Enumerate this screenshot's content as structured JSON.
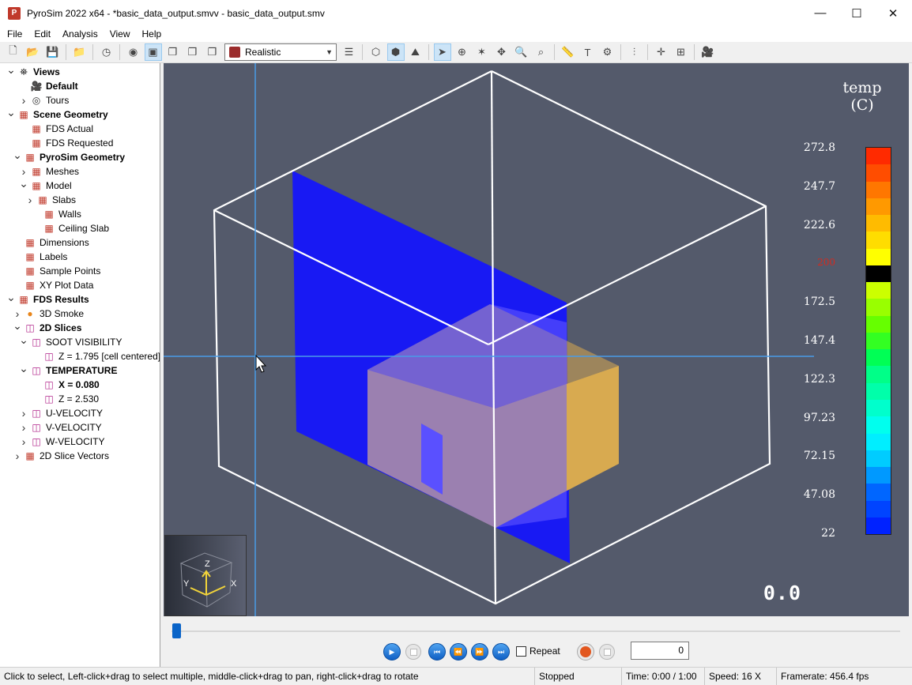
{
  "window": {
    "title": "PyroSim 2022 x64 - *basic_data_output.smvv - basic_data_output.smv",
    "minimize": "—",
    "maximize": "☐",
    "close": "✕"
  },
  "menu": [
    "File",
    "Edit",
    "Analysis",
    "View",
    "Help"
  ],
  "toolbar": {
    "render_mode": "Realistic"
  },
  "tree": [
    {
      "label": "Views",
      "bold": true,
      "toggle": "v",
      "icon": "views-icon"
    },
    {
      "label": "Default",
      "bold": true,
      "toggle": "",
      "icon": "camera-icon"
    },
    {
      "label": "Tours",
      "bold": false,
      "toggle": ">",
      "icon": "tour-icon"
    },
    {
      "label": "Scene Geometry",
      "bold": true,
      "toggle": "v",
      "icon": "geometry-icon"
    },
    {
      "label": "FDS Actual",
      "bold": false,
      "toggle": "",
      "icon": "geometry-icon"
    },
    {
      "label": "FDS Requested",
      "bold": false,
      "toggle": "",
      "icon": "geometry-icon"
    },
    {
      "label": "PyroSim Geometry",
      "bold": true,
      "toggle": "v",
      "icon": "geometry-icon"
    },
    {
      "label": "Meshes",
      "bold": false,
      "toggle": ">",
      "icon": "geometry-icon"
    },
    {
      "label": "Model",
      "bold": false,
      "toggle": "v",
      "icon": "geometry-icon"
    },
    {
      "label": "Slabs",
      "bold": false,
      "toggle": ">",
      "icon": "geometry-icon"
    },
    {
      "label": "Walls",
      "bold": false,
      "toggle": "",
      "icon": "geometry-icon"
    },
    {
      "label": "Ceiling Slab",
      "bold": false,
      "toggle": "",
      "icon": "geometry-icon"
    },
    {
      "label": "Dimensions",
      "bold": false,
      "toggle": "",
      "icon": "geometry-icon"
    },
    {
      "label": "Labels",
      "bold": false,
      "toggle": "",
      "icon": "geometry-icon"
    },
    {
      "label": "Sample Points",
      "bold": false,
      "toggle": "",
      "icon": "geometry-icon"
    },
    {
      "label": "XY Plot Data",
      "bold": false,
      "toggle": "",
      "icon": "geometry-icon"
    },
    {
      "label": "FDS Results",
      "bold": true,
      "toggle": "v",
      "icon": "geometry-icon"
    },
    {
      "label": "3D Smoke",
      "bold": false,
      "toggle": ">",
      "icon": "smoke-icon"
    },
    {
      "label": "2D Slices",
      "bold": true,
      "toggle": "v",
      "icon": "slice-icon"
    },
    {
      "label": "SOOT VISIBILITY",
      "bold": false,
      "toggle": "v",
      "icon": "slice-icon"
    },
    {
      "label": "Z = 1.795 [cell centered]",
      "bold": false,
      "toggle": "",
      "icon": "slice-icon"
    },
    {
      "label": "TEMPERATURE",
      "bold": true,
      "toggle": "v",
      "icon": "slice-icon"
    },
    {
      "label": "X = 0.080",
      "bold": true,
      "toggle": "",
      "icon": "slice-icon"
    },
    {
      "label": "Z = 2.530",
      "bold": false,
      "toggle": "",
      "icon": "slice-icon"
    },
    {
      "label": "U-VELOCITY",
      "bold": false,
      "toggle": ">",
      "icon": "slice-icon"
    },
    {
      "label": "V-VELOCITY",
      "bold": false,
      "toggle": ">",
      "icon": "slice-icon"
    },
    {
      "label": "W-VELOCITY",
      "bold": false,
      "toggle": ">",
      "icon": "slice-icon"
    },
    {
      "label": "2D Slice Vectors",
      "bold": false,
      "toggle": ">",
      "icon": "geometry-icon"
    }
  ],
  "legend": {
    "title_line1": "temp",
    "title_line2": "(C)",
    "labels": [
      "272.8",
      "247.7",
      "222.6",
      "200",
      "172.5",
      "147.4",
      "122.3",
      "97.23",
      "72.15",
      "47.08",
      "22"
    ],
    "highlight_color": "#d42a1f",
    "colors": [
      "#ff2a00",
      "#ff4d00",
      "#ff7700",
      "#ff9900",
      "#ffbb00",
      "#ffdd00",
      "#ffff00",
      "#000000",
      "#ccff00",
      "#99ff00",
      "#66ff00",
      "#33ff22",
      "#00ff55",
      "#00ff88",
      "#00ffaa",
      "#00ffcc",
      "#00ffee",
      "#00eeff",
      "#00ccff",
      "#0099ff",
      "#0066ff",
      "#0044ff",
      "#0022ff"
    ]
  },
  "viewport": {
    "time_display": "0.0",
    "axes": {
      "x": "X",
      "y": "Y",
      "z": "Z"
    },
    "slice_color": "#1414ff",
    "wall_color": "#d8aa50",
    "background": "#545a6b"
  },
  "playback": {
    "repeat_label": "Repeat",
    "frame_value": "0"
  },
  "status": {
    "hint": "Click to select, Left-click+drag to select multiple, middle-click+drag to pan, right-click+drag to rotate",
    "state": "Stopped",
    "time": "Time: 0:00 / 1:00",
    "speed": "Speed: 16 X",
    "framerate": "Framerate: 456.4 fps"
  }
}
